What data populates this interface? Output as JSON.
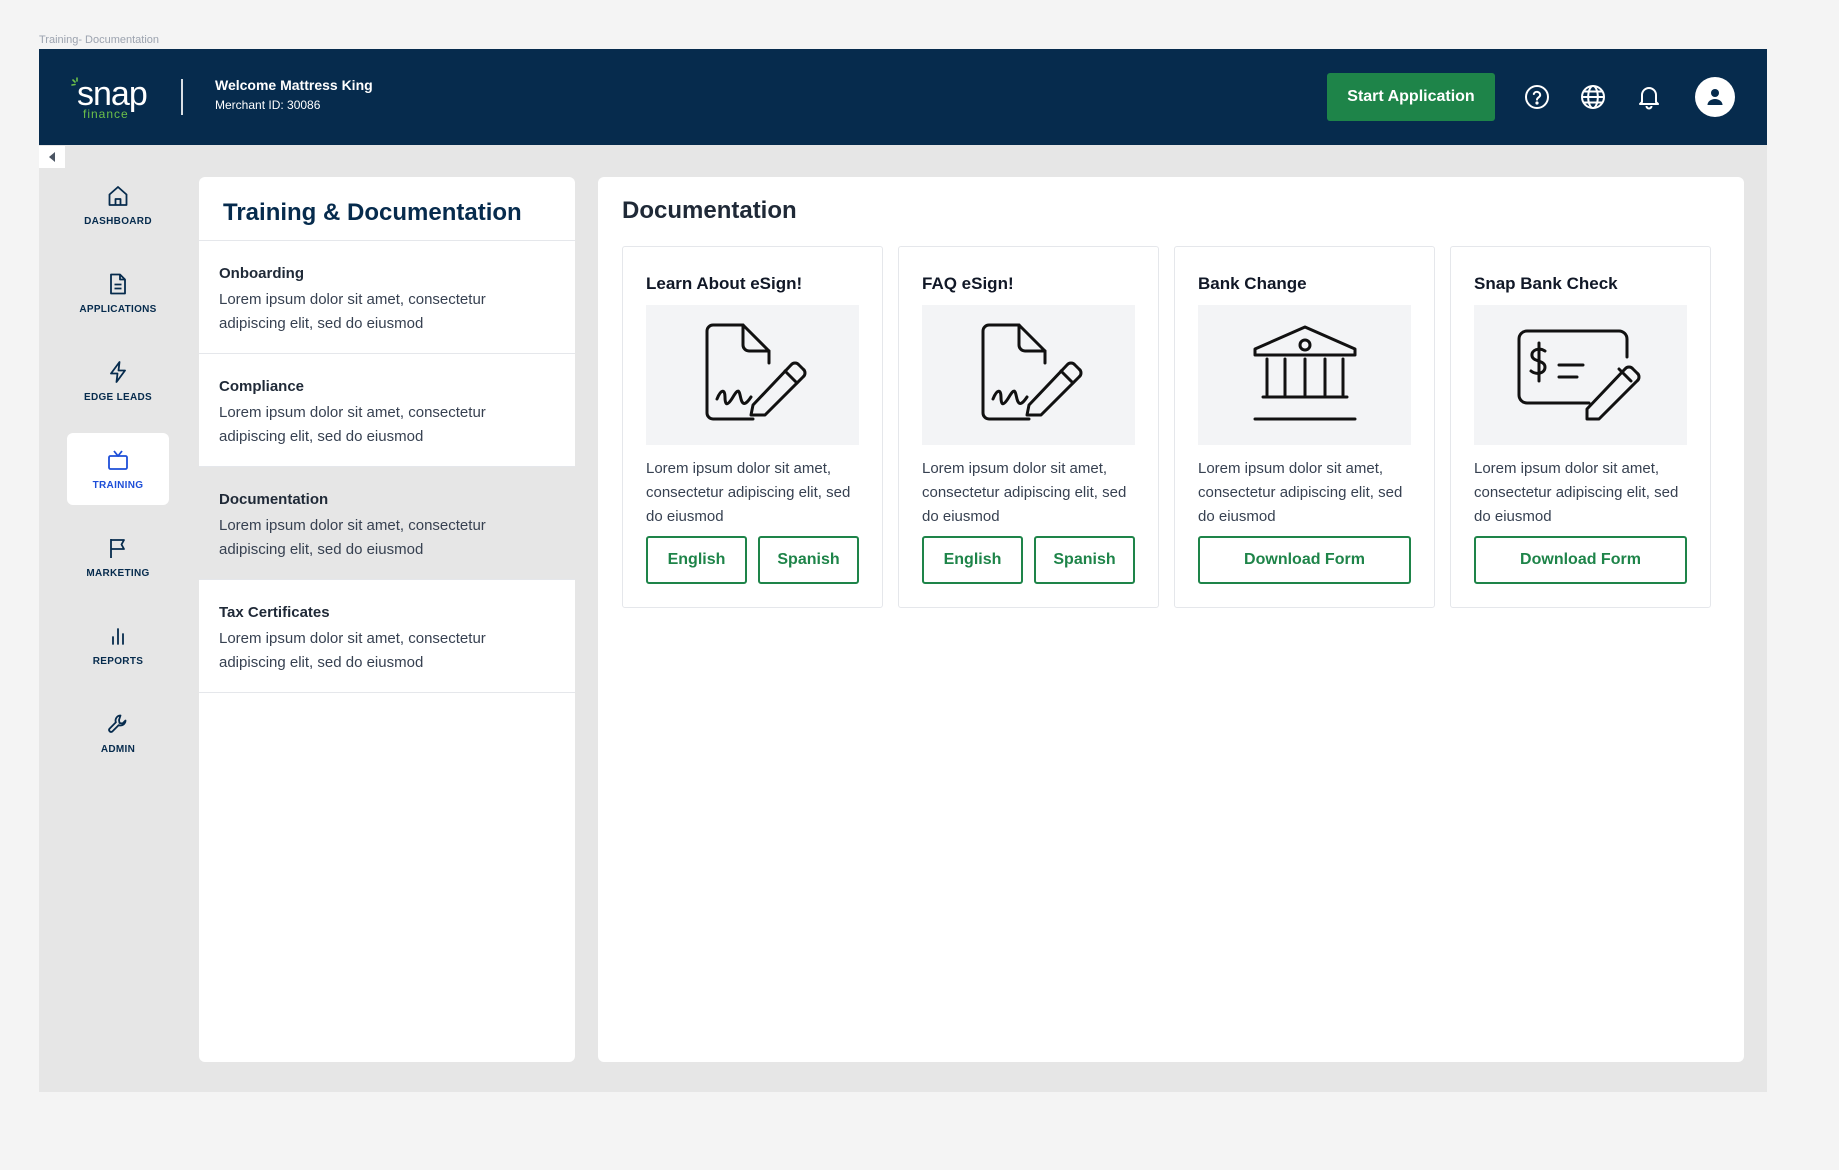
{
  "frame_label": "Training- Documentation",
  "header": {
    "logo_text": "snap",
    "logo_sub": "finance",
    "welcome_title": "Welcome Mattress King",
    "merchant_id": "Merchant ID: 30086",
    "start_button": "Start Application",
    "icons": [
      "help-circle-icon",
      "globe-icon",
      "bell-icon",
      "user-icon"
    ]
  },
  "nav": {
    "items": [
      {
        "label": "DASHBOARD",
        "icon": "home-icon"
      },
      {
        "label": "APPLICATIONS",
        "icon": "document-icon"
      },
      {
        "label": "EDGE LEADS",
        "icon": "lightning-icon"
      },
      {
        "label": "TRAINING",
        "icon": "tv-icon",
        "active": true
      },
      {
        "label": "MARKETING",
        "icon": "flag-icon"
      },
      {
        "label": "REPORTS",
        "icon": "bar-chart-icon"
      },
      {
        "label": "ADMIN",
        "icon": "wrench-icon"
      }
    ]
  },
  "left_panel": {
    "title": "Training & Documentation",
    "items": [
      {
        "title": "Onboarding",
        "desc": "Lorem ipsum dolor sit amet, consectetur adipiscing elit, sed do eiusmod"
      },
      {
        "title": "Compliance",
        "desc": "Lorem ipsum dolor sit amet, consectetur adipiscing elit, sed do eiusmod"
      },
      {
        "title": "Documentation",
        "desc": "Lorem ipsum dolor sit amet, consectetur adipiscing elit, sed do eiusmod",
        "active": true
      },
      {
        "title": "Tax Certificates",
        "desc": "Lorem ipsum dolor sit amet, consectetur adipiscing elit, sed do eiusmod"
      }
    ]
  },
  "main": {
    "title": "Documentation",
    "cards": [
      {
        "title": "Learn About eSign!",
        "icon": "esign-document-icon",
        "desc": "Lorem ipsum dolor sit amet, consectetur adipiscing elit, sed do eiusmod",
        "buttons": [
          "English",
          "Spanish"
        ]
      },
      {
        "title": "FAQ eSign!",
        "icon": "esign-document-icon",
        "desc": "Lorem ipsum dolor sit amet, consectetur adipiscing elit, sed do eiusmod",
        "buttons": [
          "English",
          "Spanish"
        ]
      },
      {
        "title": "Bank Change",
        "icon": "bank-icon",
        "desc": "Lorem ipsum dolor sit amet, consectetur adipiscing elit, sed do eiusmod",
        "buttons": [
          "Download Form"
        ]
      },
      {
        "title": "Snap Bank Check",
        "icon": "check-pen-icon",
        "desc": "Lorem ipsum dolor sit amet, consectetur adipiscing elit, sed do eiusmod",
        "buttons": [
          "Download Form"
        ]
      }
    ]
  },
  "colors": {
    "header_bg": "#062b4d",
    "accent_green": "#1e8449",
    "logo_green": "#6cc04a",
    "active_nav": "#1d4ed8"
  }
}
